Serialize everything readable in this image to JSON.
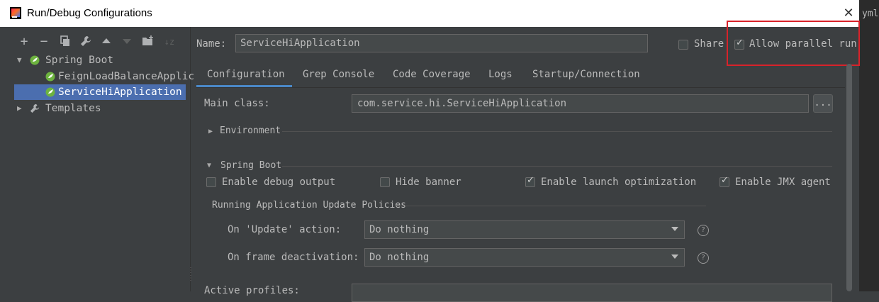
{
  "window": {
    "title": "Run/Debug Configurations",
    "close_glyph": "✕",
    "edge_text": "yml"
  },
  "toolbar": {
    "icons": [
      "add-icon",
      "remove-icon",
      "copy-icon",
      "wrench-icon",
      "move-up-icon",
      "move-down-icon",
      "new-folder-icon",
      "sort-icon"
    ]
  },
  "tree": {
    "spring_boot": "Spring Boot",
    "item_feign": "FeignLoadBalanceApplic",
    "item_service": "ServiceHiApplication",
    "templates": "Templates"
  },
  "header": {
    "name_label": "Name:",
    "name_value": "ServiceHiApplication",
    "share_label": "Share",
    "share_checked": false,
    "parallel_label": "Allow parallel run",
    "parallel_checked": true
  },
  "tabs": [
    {
      "label": "Configuration",
      "active": true
    },
    {
      "label": "Grep Console"
    },
    {
      "label": "Code Coverage"
    },
    {
      "label": "Logs"
    },
    {
      "label": "Startup/Connection"
    }
  ],
  "config": {
    "main_class_label": "Main class:",
    "main_class_value": "com.service.hi.ServiceHiApplication",
    "browse_label": "...",
    "environment_label": "Environment",
    "spring_boot_section": "Spring Boot",
    "options": [
      {
        "label": "Enable debug output",
        "checked": false
      },
      {
        "label": "Hide banner",
        "checked": false
      },
      {
        "label": "Enable launch optimization",
        "checked": true
      },
      {
        "label": "Enable JMX agent",
        "checked": true
      }
    ],
    "policies_label": "Running Application Update Policies",
    "on_update_label": "On 'Update' action:",
    "on_update_value": "Do nothing",
    "on_frame_label": "On frame deactivation:",
    "on_frame_value": "Do nothing",
    "active_profiles_label": "Active profiles:"
  },
  "colors": {
    "background": "#3c3f41",
    "selection": "#4b6eaf",
    "accent": "#4a88c7",
    "highlight_box": "#d8222a"
  }
}
